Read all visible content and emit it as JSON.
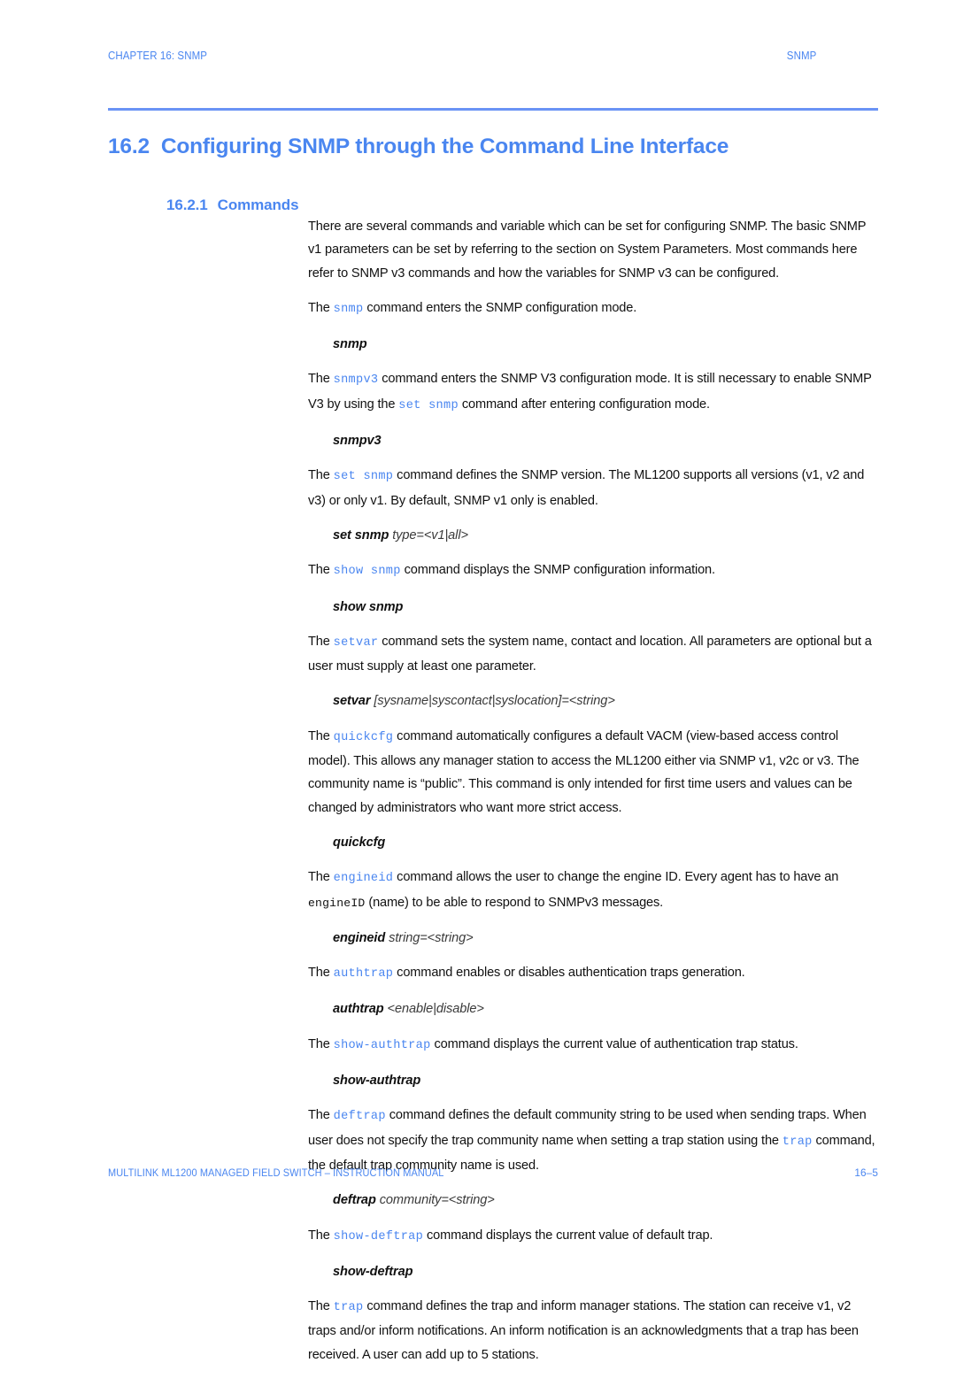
{
  "header": {
    "chapter": "CHAPTER 16: SNMP",
    "right": "SNMP"
  },
  "section": {
    "number": "16.2",
    "title": "Configuring SNMP through the Command Line Interface"
  },
  "subsection": {
    "number": "16.2.1",
    "title": "Commands"
  },
  "body": {
    "intro": {
      "p1_a": "There are several commands and variable which can be set for configuring SNMP. The basic SNMP v1 parameters can be set by referring to the section on System Parameters. Most commands here refer to SNMP v3 commands and how the variables for SNMP v3 can be configured."
    },
    "snmp": {
      "lead_a": "The ",
      "cmd": "snmp",
      "lead_b": " command enters the SNMP configuration mode.",
      "syntax_name": "snmp",
      "syntax_args": ""
    },
    "snmpv3": {
      "lead_a": "The ",
      "cmd": "snmpv3",
      "lead_b": " command enters the SNMP V3 configuration mode. It is still necessary to enable SNMP V3 by using the ",
      "cmd2": "set snmp",
      "lead_c": " command after entering configuration mode.",
      "syntax_name": "snmpv3",
      "syntax_args": ""
    },
    "set_snmp": {
      "lead_a": "The ",
      "cmd": "set snmp",
      "lead_b": " command defines the SNMP version. The ML1200 supports all versions (v1, v2 and v3) or only v1. By default, SNMP v1 only is enabled.",
      "syntax_name": "set snmp",
      "syntax_args": " type=<v1|all>"
    },
    "show_snmp": {
      "lead_a": "The ",
      "cmd": "show snmp",
      "lead_b": " command displays the SNMP configuration information.",
      "syntax_name": "show snmp",
      "syntax_args": ""
    },
    "setvar": {
      "lead_a": "The ",
      "cmd": "setvar",
      "lead_b": " command sets the system name, contact and location. All parameters are optional but a user must supply at least one parameter.",
      "syntax_name": "setvar",
      "syntax_args": " [sysname|syscontact|syslocation]=<string>"
    },
    "quickcfg": {
      "lead_a": "The ",
      "cmd": "quickcfg",
      "lead_b": " command automatically configures a default VACM (view-based access control model). This allows any manager station to access the ML1200 either via SNMP v1, v2c or v3. The community name is “public”. This command is only intended for first time users and values can be changed by administrators who want more strict access.",
      "syntax_name": "quickcfg",
      "syntax_args": ""
    },
    "engineid": {
      "lead_a": "The ",
      "cmd": "engineid",
      "lead_b": " command allows the user to change the engine ID. Every agent has to have an ",
      "mono": "engineID",
      "lead_c": " (name) to be able to respond to SNMPv3 messages.",
      "syntax_name": "engineid",
      "syntax_args": " string=<string>"
    },
    "authtrap": {
      "lead_a": "The ",
      "cmd": "authtrap",
      "lead_b": " command enables or disables authentication traps generation.",
      "syntax_name": "authtrap",
      "syntax_args": " <enable|disable>"
    },
    "show_authtrap": {
      "lead_a": "The ",
      "cmd": "show-authtrap",
      "lead_b": " command displays the current value of authentication trap status.",
      "syntax_name": "show-authtrap",
      "syntax_args": ""
    },
    "deftrap": {
      "lead_a": "The ",
      "cmd": "deftrap",
      "lead_b": " command defines the default community string to be used when sending traps. When user does not specify the trap community name when setting a trap station using the ",
      "cmd2": "trap",
      "lead_c": " command, the default trap community name is used.",
      "syntax_name": "deftrap",
      "syntax_args": " community=<string>"
    },
    "show_deftrap": {
      "lead_a": "The ",
      "cmd": "show-deftrap",
      "lead_b": " command displays the current value of default trap.",
      "syntax_name": "show-deftrap",
      "syntax_args": ""
    },
    "trap": {
      "lead_a": "The ",
      "cmd": "trap",
      "lead_b": " command defines the trap and inform manager stations. The station can receive v1, v2 traps and/or inform notifications. An inform notification is an acknowledgments that a trap has been received. A user can add up to 5 stations."
    }
  },
  "footer": {
    "left": "MULTILINK ML1200 MANAGED FIELD SWITCH – INSTRUCTION MANUAL",
    "right": "16–5"
  },
  "colors": {
    "accent_blue": "#4a86f0",
    "rule_blue": "#6a93f5",
    "body_black": "#111111"
  }
}
